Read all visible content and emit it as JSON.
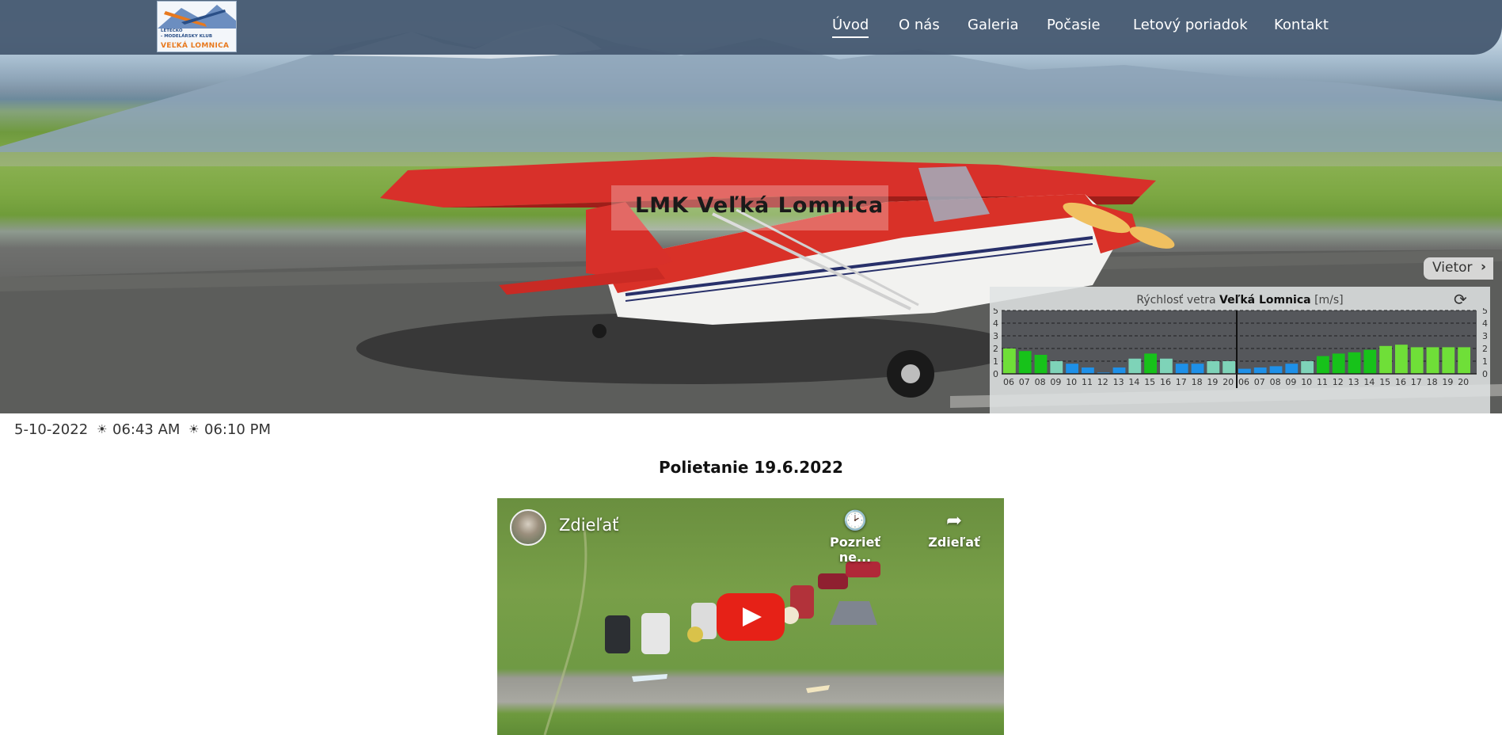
{
  "nav": {
    "logo": {
      "line1": "LETECKO",
      "line2": "- MODELÁRSKY KLUB",
      "line3": "VEĽKÁ LOMNICA"
    },
    "items": [
      "Úvod",
      "O nás",
      "Galeria",
      "Počasie",
      "Letový poriadok",
      "Kontakt"
    ],
    "active": "Úvod"
  },
  "hero": {
    "title": "LMK Veľká Lomnica"
  },
  "wind": {
    "tab_label": "Vietor",
    "caption_prefix": "Rýchlosť vetra",
    "caption_place": "Veľká Lomnica",
    "caption_unit": "[m/s]",
    "y_ticks": [
      "5",
      "4",
      "3",
      "2",
      "1",
      "0"
    ],
    "hours_day1": [
      "06",
      "07",
      "08",
      "09",
      "10",
      "11",
      "12",
      "13",
      "14",
      "15",
      "16",
      "17",
      "18",
      "19",
      "20"
    ],
    "hours_day2": [
      "06",
      "07",
      "08",
      "09",
      "10",
      "11",
      "12",
      "13",
      "14",
      "15",
      "16",
      "17",
      "18",
      "19",
      "20"
    ],
    "values_day1": [
      2.0,
      1.8,
      1.5,
      1.0,
      0.8,
      0.5,
      0.1,
      0.5,
      1.2,
      1.6,
      1.2,
      0.8,
      0.8,
      1.0,
      1.0
    ],
    "values_day2": [
      0.4,
      0.5,
      0.6,
      0.8,
      1.0,
      1.4,
      1.6,
      1.7,
      1.9,
      2.2,
      2.3,
      2.1,
      2.1,
      2.1,
      2.1
    ],
    "colors": {
      "calm": "#1e90e8",
      "light": "#7ed3b8",
      "moderate": "#17c21a",
      "fresh": "#6fdf38"
    }
  },
  "info": {
    "date": "5-10-2022",
    "sunrise": "06:43 AM",
    "sunset": "06:10 PM"
  },
  "post": {
    "title": "Polietanie 19.6.2022"
  },
  "video": {
    "title": "Zdieľať",
    "watch_later": "Pozrieť ne...",
    "share": "Zdieľať"
  }
}
